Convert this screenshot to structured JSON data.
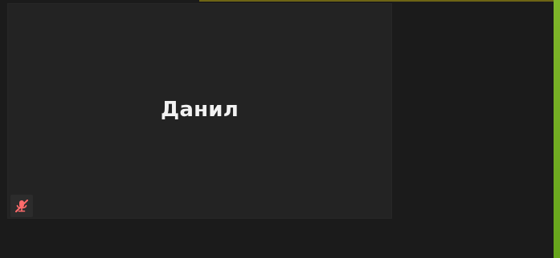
{
  "participant": {
    "name": "Данил",
    "mic_icon": "microphone-muted-icon",
    "mic_color": "#ff6b6b"
  },
  "colors": {
    "background": "#1b1b1b",
    "tile_background": "#232323",
    "top_accent": "#6e6414",
    "right_accent": "#7fb52a"
  }
}
